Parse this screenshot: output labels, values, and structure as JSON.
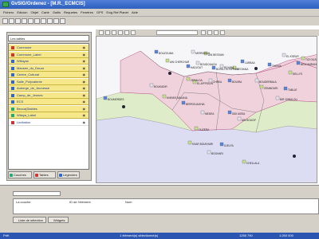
{
  "window": {
    "title": "GvSIG/Ordenez - [M.R._ECMCIS]"
  },
  "menu": [
    "Fichero",
    "Edicion",
    "Objet",
    "Carte",
    "Outils",
    "Requetes",
    "Fenetres",
    "GPS",
    "Ecig Ref.Planet",
    "Aide"
  ],
  "layers_panel": {
    "title": "Les tables",
    "layers": [
      {
        "name": "Commune",
        "color": "#c33"
      },
      {
        "name": "Commune_Label",
        "color": "#c33"
      },
      {
        "name": "Willayas",
        "color": "#36c"
      },
      {
        "name": "Mausee_du_Douar",
        "color": "#36c"
      },
      {
        "name": "Centre_Cultural",
        "color": "#36c"
      },
      {
        "name": "Salle_Polyvalente",
        "color": "#36c"
      },
      {
        "name": "Auberge_de_Jeunesse",
        "color": "#36c"
      },
      {
        "name": "Camp_de_Jeunes",
        "color": "#36c"
      },
      {
        "name": "ECS",
        "color": "#36c"
      },
      {
        "name": "Becca(Diables",
        "color": "#2a7"
      },
      {
        "name": "Wilaya_Label",
        "color": "#2a7"
      },
      {
        "name": "Limitation",
        "color": "#c33"
      }
    ],
    "tabs": [
      "Couches",
      "Tables",
      "Légendes"
    ]
  },
  "map": {
    "labels": [
      "AIN CHERCHAR",
      "BOUZOUMA",
      "MERRABAH",
      "AIN BESSAM",
      "HADJOUT",
      "BOUDOUAOU",
      "ZERALDA",
      "BORDJ EL KIFFAN",
      "ROUIBA",
      "REGHAIA",
      "LARBAA",
      "CHREA",
      "EL AFFROUN",
      "BOUIRA",
      "BOUDERBALA",
      "ZEMMOURI",
      "TABLAT",
      "BIR GHBALOU",
      "DELLYS",
      "BENI AMRANE",
      "BOUKADIR",
      "KHEMIS MILIANA",
      "BERROUAGHIA",
      "MEDEA",
      "OUZERA",
      "SIDI AISSA",
      "AIN BOUCIF",
      "KSAR BOUKHARI",
      "DJELFA",
      "BOGHARI",
      "CHELLALA",
      "THENIA",
      "EL KSEUR",
      "TIZI OUZOU",
      "BOUMERDES"
    ]
  },
  "bottom": {
    "columns": [
      "La couche",
      "ID de l'élément",
      "Nom"
    ],
    "tabs": [
      "Liste de sélection",
      "Widgets"
    ]
  },
  "status": {
    "left": "Prêt",
    "middle": "1 élément(s) sélectionné(s)",
    "coords": "1255 790",
    "scale": "1:250 000"
  },
  "colors": {
    "title_blue": "#2f5fbf",
    "layer_yellow": "#f6e78a",
    "region_pink": "#f0d2dc",
    "region_green": "#dfecc9",
    "region_blue": "#dcdcf2"
  }
}
